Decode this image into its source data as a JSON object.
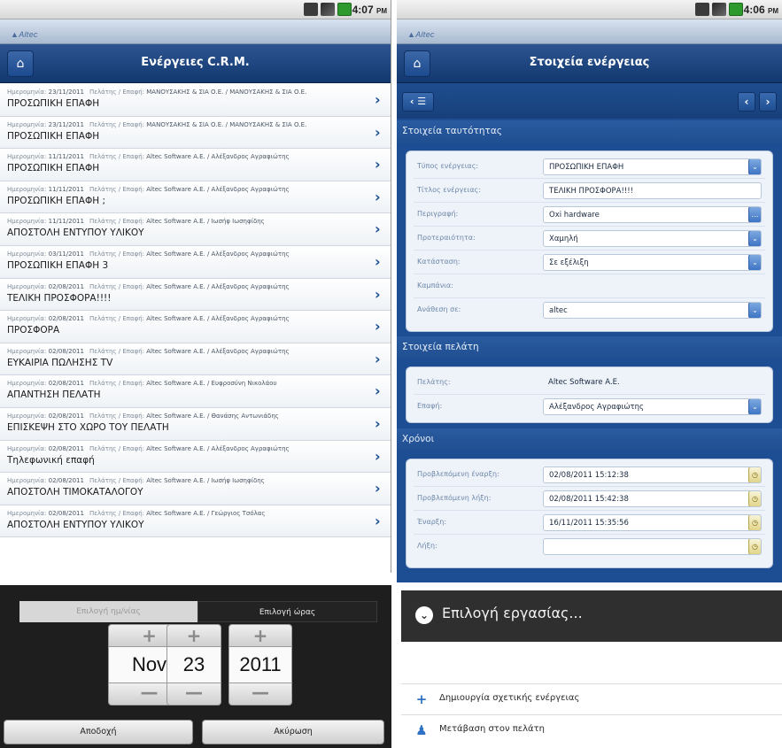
{
  "list_screen": {
    "status_time": "4:07",
    "status_ampm": "PM",
    "title": "Ενέργειες C.R.M.",
    "meta_label_date": "Ημερομηνία:",
    "meta_label_customer": "Πελάτης / Επαφή:",
    "rows": [
      {
        "date": "23/11/2011",
        "customer": "ΜΑΝΟΥΣΑΚΗΣ & ΣΙΑ Ο.Ε. / ΜΑΝΟΥΣΑΚΗΣ & ΣΙΑ Ο.Ε.",
        "title": "ΠΡΟΣΩΠΙΚΗ ΕΠΑΦΗ"
      },
      {
        "date": "23/11/2011",
        "customer": "ΜΑΝΟΥΣΑΚΗΣ & ΣΙΑ Ο.Ε. / ΜΑΝΟΥΣΑΚΗΣ & ΣΙΑ Ο.Ε.",
        "title": "ΠΡΟΣΩΠΙΚΗ ΕΠΑΦΗ"
      },
      {
        "date": "11/11/2011",
        "customer": "Altec Software A.E. / Αλέξανδρος Αγραφιώτης",
        "title": "ΠΡΟΣΩΠΙΚΗ ΕΠΑΦΗ"
      },
      {
        "date": "11/11/2011",
        "customer": "Altec Software A.E. / Αλέξανδρος Αγραφιώτης",
        "title": "ΠΡΟΣΩΠΙΚΗ ΕΠΑΦΗ ;"
      },
      {
        "date": "11/11/2011",
        "customer": "Altec Software A.E. / Ιωσήφ Ιωσηφίδης",
        "title": "ΑΠΟΣΤΟΛΗ ΕΝΤΥΠΟΥ ΥΛΙΚΟΥ"
      },
      {
        "date": "03/11/2011",
        "customer": "Altec Software A.E. / Αλέξανδρος Αγραφιώτης",
        "title": "ΠΡΟΣΩΠΙΚΗ ΕΠΑΦΗ 3"
      },
      {
        "date": "02/08/2011",
        "customer": "Altec Software A.E. / Αλέξανδρος Αγραφιώτης",
        "title": "ΤΕΛΙΚΗ ΠΡΟΣΦΟΡΑ!!!!"
      },
      {
        "date": "02/08/2011",
        "customer": "Altec Software A.E. / Αλέξανδρος Αγραφιώτης",
        "title": "ΠΡΟΣΦΟΡΑ"
      },
      {
        "date": "02/08/2011",
        "customer": "Altec Software A.E. / Αλέξανδρος Αγραφιώτης",
        "title": "ΕΥΚΑΙΡΙΑ ΠΩΛΗΣΗΣ TV"
      },
      {
        "date": "02/08/2011",
        "customer": "Altec Software A.E. / Ευφροσύνη Νικολάου",
        "title": "ΑΠΑΝΤΗΣΗ ΠΕΛΑΤΗ"
      },
      {
        "date": "02/08/2011",
        "customer": "Altec Software A.E. / Θανάσης Αντωνιάδης",
        "title": "ΕΠΙΣΚΕΨΗ ΣΤΟ ΧΩΡΟ ΤΟΥ ΠΕΛΑΤΗ"
      },
      {
        "date": "02/08/2011",
        "customer": "Altec Software A.E. / Αλέξανδρος Αγραφιώτης",
        "title": "Τηλεφωνική επαφή"
      },
      {
        "date": "02/08/2011",
        "customer": "Altec Software A.E. / Ιωσήφ Ιωσηφίδης",
        "title": "ΑΠΟΣΤΟΛΗ ΤΙΜΟΚΑΤΑΛΟΓΟΥ"
      },
      {
        "date": "02/08/2011",
        "customer": "Altec Software A.E. / Γεώργιος Τσόλας",
        "title": "ΑΠΟΣΤΟΛΗ ΕΝΤΥΠΟΥ ΥΛΙΚΟΥ"
      }
    ]
  },
  "detail_screen": {
    "status_time": "4:06",
    "status_ampm": "PM",
    "title": "Στοιχεία ενέργειας",
    "sections": {
      "identity": "Στοιχεία ταυτότητας",
      "customer": "Στοιχεία πελάτη",
      "times": "Χρόνοι"
    },
    "identity_fields": [
      {
        "label": "Τύπος ενέργειας:",
        "value": "ΠΡΟΣΩΠΙΚΗ ΕΠΑΦΗ"
      },
      {
        "label": "Τίτλος ενέργειας:",
        "value": "ΤΕΛΙΚΗ ΠΡΟΣΦΟΡΑ!!!!"
      },
      {
        "label": "Περιγραφή:",
        "value": "Oxi hardware"
      },
      {
        "label": "Προτεραιότητα:",
        "value": "Χαμηλή"
      },
      {
        "label": "Κατάσταση:",
        "value": "Σε εξέλιξη"
      },
      {
        "label": "Καμπάνια:",
        "value": ""
      },
      {
        "label": "Ανάθεση σε:",
        "value": "altec"
      }
    ],
    "customer_fields": [
      {
        "label": "Πελάτης:",
        "value": "Altec Software A.E."
      },
      {
        "label": "Επαφή:",
        "value": "Αλέξανδρος Αγραφιώτης"
      }
    ],
    "time_fields": [
      {
        "label": "Προβλεπόμενη έναρξη:",
        "value": "02/08/2011 15:12:38"
      },
      {
        "label": "Προβλεπόμενη λήξη:",
        "value": "02/08/2011 15:42:38"
      },
      {
        "label": "Έναρξη:",
        "value": "16/11/2011 15:35:56"
      },
      {
        "label": "Λήξη:",
        "value": ""
      }
    ]
  },
  "date_picker": {
    "tab_date": "Επιλογή ημ/νίας",
    "tab_time": "Επιλογή ώρας",
    "month": "Nov",
    "day": "23",
    "year": "2011",
    "plus": "+",
    "minus": "—",
    "accept": "Αποδοχή",
    "cancel": "Ακύρωση"
  },
  "task_menu": {
    "title": "Επιλογή εργασίας...",
    "items": [
      {
        "label": "Δημιουργία σχετικής ενέργειας",
        "icon": "plus-icon"
      },
      {
        "label": "Μετάβαση στον πελάτη",
        "icon": "person-icon"
      }
    ]
  },
  "colors": {
    "header_blue": "#12386f",
    "form_blue": "#1d4e93",
    "menu_dark": "#2f2f2f"
  }
}
